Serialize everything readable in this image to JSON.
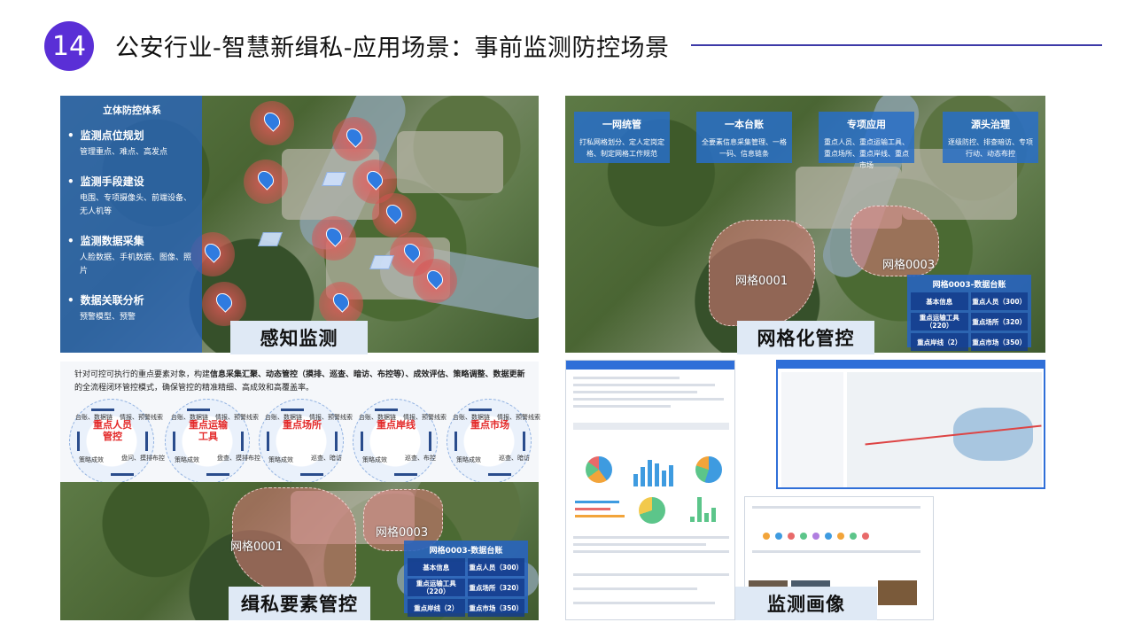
{
  "header": {
    "number": "14",
    "title": "公安行业-智慧新缉私-应用场景：事前监测防控场景"
  },
  "panel_perception": {
    "label": "感知监测",
    "side": {
      "heading": "立体防控体系",
      "items": [
        {
          "title": "监测点位规划",
          "desc": "管理重点、难点、高发点"
        },
        {
          "title": "监测手段建设",
          "desc": "电围、专项摄像头、前端设备、无人机等"
        },
        {
          "title": "监测数据采集",
          "desc": "人脸数据、手机数据、图像、照片"
        },
        {
          "title": "数据关联分析",
          "desc": "预警模型、预警"
        }
      ]
    }
  },
  "panel_grid": {
    "label": "网格化管控",
    "cards": [
      {
        "title": "一网统管",
        "desc": "打私网格划分、定人定岗定格、制定网格工作规范"
      },
      {
        "title": "一本台账",
        "desc": "全要素信息采集管理、一格一码、信息链条"
      },
      {
        "title": "专项应用",
        "desc": "重点人员、重点运输工具、重点场所、重点岸线、重点市场"
      },
      {
        "title": "源头治理",
        "desc": "逐级防控、排查暗访、专项行动、动态布控"
      }
    ],
    "zones": [
      "网格0001",
      "网格0003"
    ],
    "ledger": {
      "title": "网格0003-数据台账",
      "rows": [
        [
          "基本信息",
          "重点人员（300）"
        ],
        [
          "重点运输工具（220）",
          "重点场所（320）"
        ],
        [
          "重点岸线（2）",
          "重点市场（350）"
        ]
      ]
    }
  },
  "panel_elements": {
    "label": "缉私要素管控",
    "intro_plain1": "针对可控可执行的重点要素对象，构建",
    "intro_bold": "信息采集汇聚、动态管控（摸排、巡查、暗访、布控等）、成效评估、策略调整、数据更新",
    "intro_plain2": "的全流程闭环管控模式，确保管控的精准精细、高成效和高覆盖率。",
    "rings": [
      {
        "center": "重点人员管控",
        "tl": "台账、数据链",
        "tr": "情报、预警线索",
        "bl": "策略成效",
        "br": "盘问、摸排布控"
      },
      {
        "center": "重点运输工具",
        "tl": "台账、数据链",
        "tr": "情报、预警线索",
        "bl": "策略成效",
        "br": "盘查、摸排布控"
      },
      {
        "center": "重点场所",
        "tl": "台账、数据链",
        "tr": "情报、预警线索",
        "bl": "策略成效",
        "br": "巡查、暗访"
      },
      {
        "center": "重点岸线",
        "tl": "台账、数据链",
        "tr": "情报、预警线索",
        "bl": "策略成效",
        "br": "巡查、布控"
      },
      {
        "center": "重点市场",
        "tl": "台账、数据链",
        "tr": "情报、预警线索",
        "bl": "策略成效",
        "br": "巡查、暗访"
      }
    ],
    "zones": [
      "网格0001",
      "网格0003"
    ],
    "ledger": {
      "title": "网格0003-数据台账",
      "rows": [
        [
          "基本信息",
          "重点人员（300）"
        ],
        [
          "重点运输工具（220）",
          "重点场所（320）"
        ],
        [
          "重点岸线（2）",
          "重点市场（350）"
        ]
      ]
    }
  },
  "panel_portrait": {
    "label": "监测画像"
  },
  "colors": {
    "accent": "#5a2fd6",
    "title_rule": "#3d3aa8",
    "panel_blue": "#2864be",
    "label_bg": "#dfe9f5",
    "highlight_red": "#e32a2a"
  }
}
